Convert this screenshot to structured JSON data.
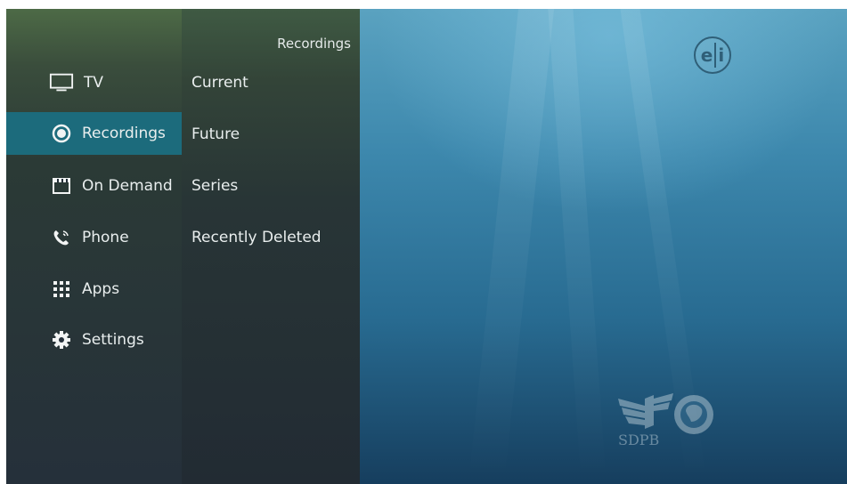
{
  "main_menu": {
    "items": [
      {
        "label": "TV",
        "icon": "tv-icon"
      },
      {
        "label": "Recordings",
        "icon": "record-icon",
        "active": true
      },
      {
        "label": "On Demand",
        "icon": "clapperboard-icon"
      },
      {
        "label": "Phone",
        "icon": "phone-icon"
      },
      {
        "label": "Apps",
        "icon": "apps-grid-icon"
      },
      {
        "label": "Settings",
        "icon": "gear-icon"
      }
    ]
  },
  "submenu": {
    "title": "Recordings",
    "items": [
      "Current",
      "Future",
      "Series",
      "Recently Deleted"
    ]
  },
  "video": {
    "channel_watermark": "SDPB",
    "corner_badge": "e|i"
  },
  "colors": {
    "active_highlight": "#1c6b7c",
    "text": "#e9eeee"
  }
}
